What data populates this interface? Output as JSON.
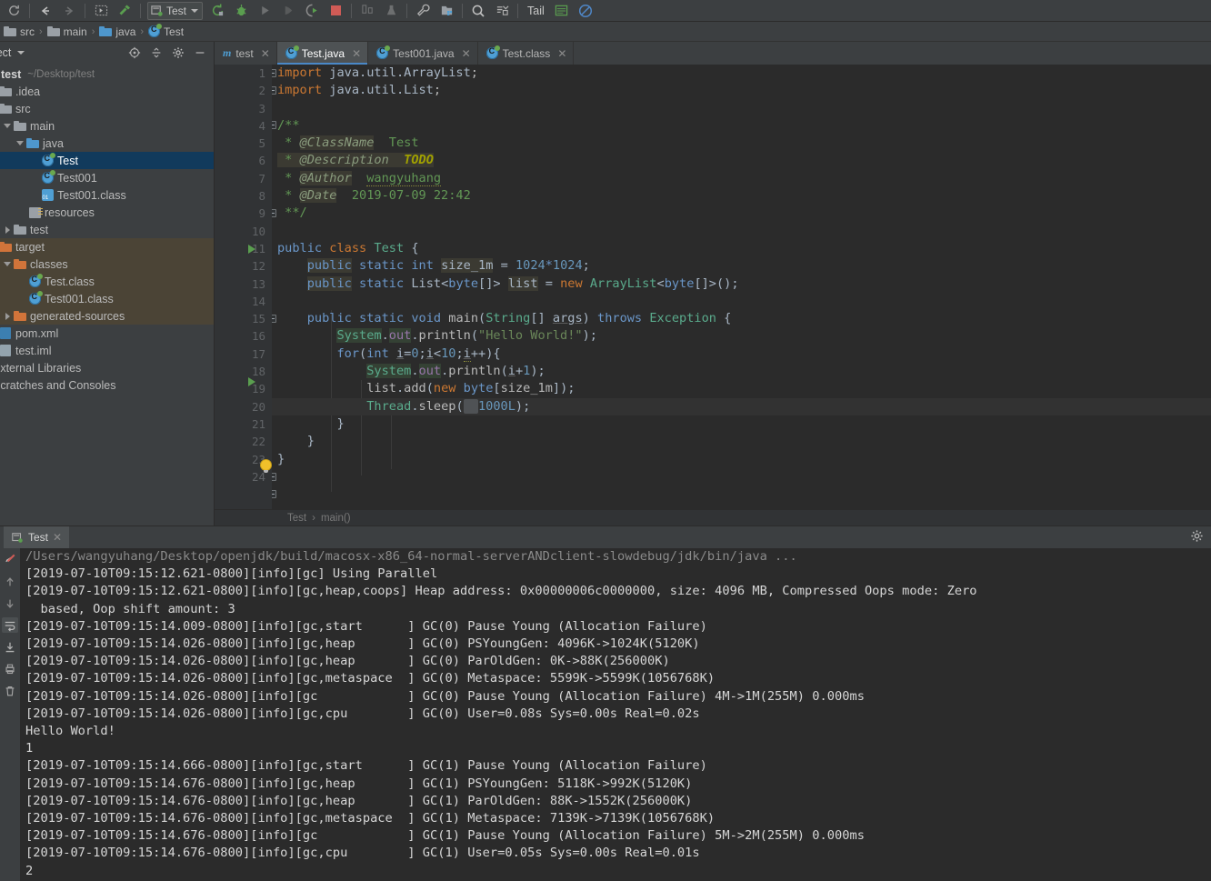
{
  "toolbar": {
    "icons": [
      "sync-icon",
      "back-arrow-icon",
      "forward-arrow-icon",
      "open-in-terminal-icon",
      "build-hammer-icon"
    ],
    "run_config": {
      "label": "Test"
    },
    "right_icons": [
      "rerun-icon",
      "debug-bug-icon",
      "run-icon",
      "run-with-coverage-icon",
      "run-profile-icon",
      "stop-icon",
      "compare-icon",
      "analyze-icon",
      "settings-wrench-icon",
      "project-structure-icon",
      "search-icon",
      "commit-icon",
      "tail-plugin-icon",
      "block-icon"
    ],
    "tail_label": "Tail"
  },
  "breadcrumb": {
    "items": [
      {
        "label": "src",
        "icon": "folder-grey-icon"
      },
      {
        "label": "main",
        "icon": "folder-grey-icon"
      },
      {
        "label": "java",
        "icon": "folder-blue-icon"
      },
      {
        "label": "Test",
        "icon": "java-class-icon"
      }
    ],
    "separator": "›"
  },
  "sidebar": {
    "title": "oject",
    "actions": [
      "locate-target-icon",
      "collapse-all-icon",
      "settings-gear-icon",
      "hide-minimize-icon"
    ],
    "tree": [
      {
        "label": "test",
        "sub": "~/Desktop/test",
        "icon": "project-root-icon",
        "indent": 0,
        "twisty": "none",
        "bold": true
      },
      {
        "label": ".idea",
        "icon": "folder-grey-icon",
        "indent": 0,
        "twisty": "none"
      },
      {
        "label": "src",
        "icon": "folder-grey-icon",
        "indent": 0,
        "twisty": "none"
      },
      {
        "label": "main",
        "icon": "folder-grey-icon",
        "indent": 1,
        "twisty": "down"
      },
      {
        "label": "java",
        "icon": "folder-blue-icon",
        "indent": 2,
        "twisty": "down"
      },
      {
        "label": "Test",
        "icon": "java-class-icon",
        "indent": 4,
        "twisty": "none",
        "selected": true
      },
      {
        "label": "Test001",
        "icon": "java-class-icon",
        "indent": 4,
        "twisty": "none"
      },
      {
        "label": "Test001.class",
        "icon": "class-binary-icon",
        "indent": 4,
        "twisty": "none"
      },
      {
        "label": "resources",
        "icon": "resources-folder-icon",
        "indent": 3,
        "twisty": "none"
      },
      {
        "label": "test",
        "icon": "folder-grey-icon",
        "indent": 1,
        "twisty": "right"
      },
      {
        "label": "target",
        "icon": "folder-orange-icon",
        "indent": 0,
        "twisty": "none",
        "excluded": true
      },
      {
        "label": "classes",
        "icon": "folder-orange-icon",
        "indent": 1,
        "twisty": "down",
        "excluded": true
      },
      {
        "label": "Test.class",
        "icon": "java-class-icon",
        "indent": 3,
        "twisty": "none",
        "excluded": true
      },
      {
        "label": "Test001.class",
        "icon": "java-class-icon",
        "indent": 3,
        "twisty": "none",
        "excluded": true
      },
      {
        "label": "generated-sources",
        "icon": "folder-orange-icon",
        "indent": 1,
        "twisty": "right",
        "excluded": true
      },
      {
        "label": "pom.xml",
        "icon": "maven-file-icon",
        "indent": 0,
        "twisty": "none"
      },
      {
        "label": "test.iml",
        "icon": "iml-file-icon",
        "indent": 0,
        "twisty": "none"
      },
      {
        "label": "External Libraries",
        "icon": "library-icon",
        "indent": 0,
        "twisty": "none"
      },
      {
        "label": "Scratches and Consoles",
        "icon": "scratches-icon",
        "indent": 0,
        "twisty": "none"
      }
    ]
  },
  "editor": {
    "tabs": [
      {
        "label": "test",
        "icon": "maven-icon",
        "active": false,
        "closable": true
      },
      {
        "label": "Test.java",
        "icon": "java-class-icon",
        "active": true,
        "closable": true
      },
      {
        "label": "Test001.java",
        "icon": "java-class-icon",
        "active": false,
        "closable": true
      },
      {
        "label": "Test.class",
        "icon": "java-class-icon",
        "active": false,
        "closable": true
      }
    ],
    "line_numbers": [
      "1",
      "2",
      "3",
      "4",
      "5",
      "6",
      "7",
      "8",
      "9",
      "10",
      "11",
      "12",
      "13",
      "14",
      "15",
      "16",
      "17",
      "18",
      "19",
      "20",
      "21",
      "22",
      "23",
      "24"
    ],
    "current_line": 20,
    "code_lines": [
      "import java.util.ArrayList;",
      "import java.util.List;",
      "",
      "/**",
      " * @ClassName  Test",
      " * @Description  TODO",
      " * @Author  wangyuhang",
      " * @Date  2019-07-09 22:42",
      " **/",
      "",
      "public class Test {",
      "    public static int size_1m = 1024*1024;",
      "    public static List<byte[]> list = new ArrayList<byte[]>();",
      "",
      "    public static void main(String[] args) throws Exception {",
      "        System.out.println(\"Hello World!\");",
      "        for(int i=0;i<10;i++){",
      "            System.out.println(i+1);",
      "            list.add(new byte[size_1m]);",
      "            Thread.sleep( 1000L);",
      "        }",
      "    }",
      "}",
      ""
    ],
    "footer_breadcrumb": {
      "class_name": "Test",
      "method_name": "main()",
      "separator": "›"
    }
  },
  "console": {
    "tab": {
      "label": "Test",
      "icon": "run-config-icon",
      "closable": true
    },
    "gear_icon": "settings-gear-icon",
    "rail_icons": [
      "rerun-red-icon",
      "up-arrow-icon",
      "down-arrow-icon",
      "soft-wrap-icon",
      "scroll-to-end-icon",
      "print-icon",
      "clear-all-icon"
    ],
    "command_line": "/Users/wangyuhang/Desktop/openjdk/build/macosx-x86_64-normal-serverANDclient-slowdebug/jdk/bin/java ...",
    "lines": [
      "[2019-07-10T09:15:12.621-0800][info][gc] Using Parallel",
      "[2019-07-10T09:15:12.621-0800][info][gc,heap,coops] Heap address: 0x00000006c0000000, size: 4096 MB, Compressed Oops mode: Zero",
      "  based, Oop shift amount: 3",
      "[2019-07-10T09:15:14.009-0800][info][gc,start      ] GC(0) Pause Young (Allocation Failure)",
      "[2019-07-10T09:15:14.026-0800][info][gc,heap       ] GC(0) PSYoungGen: 4096K->1024K(5120K)",
      "[2019-07-10T09:15:14.026-0800][info][gc,heap       ] GC(0) ParOldGen: 0K->88K(256000K)",
      "[2019-07-10T09:15:14.026-0800][info][gc,metaspace  ] GC(0) Metaspace: 5599K->5599K(1056768K)",
      "[2019-07-10T09:15:14.026-0800][info][gc            ] GC(0) Pause Young (Allocation Failure) 4M->1M(255M) 0.000ms",
      "[2019-07-10T09:15:14.026-0800][info][gc,cpu        ] GC(0) User=0.08s Sys=0.00s Real=0.02s",
      "Hello World!",
      "1",
      "[2019-07-10T09:15:14.666-0800][info][gc,start      ] GC(1) Pause Young (Allocation Failure)",
      "[2019-07-10T09:15:14.676-0800][info][gc,heap       ] GC(1) PSYoungGen: 5118K->992K(5120K)",
      "[2019-07-10T09:15:14.676-0800][info][gc,heap       ] GC(1) ParOldGen: 88K->1552K(256000K)",
      "[2019-07-10T09:15:14.676-0800][info][gc,metaspace  ] GC(1) Metaspace: 7139K->7139K(1056768K)",
      "[2019-07-10T09:15:14.676-0800][info][gc            ] GC(1) Pause Young (Allocation Failure) 5M->2M(255M) 0.000ms",
      "[2019-07-10T09:15:14.676-0800][info][gc,cpu        ] GC(1) User=0.05s Sys=0.00s Real=0.01s",
      "2"
    ]
  },
  "colors": {
    "chrome": "#3c3f41",
    "editor_bg": "#2b2b2b",
    "gutter_bg": "#313335",
    "selection_blue": "#113a5c",
    "excluded_bg": "#4b4436",
    "accent": "#4a88c7",
    "keyword": "#cc7832",
    "string": "#6a8759",
    "number": "#6897bb",
    "comment": "#629755"
  }
}
